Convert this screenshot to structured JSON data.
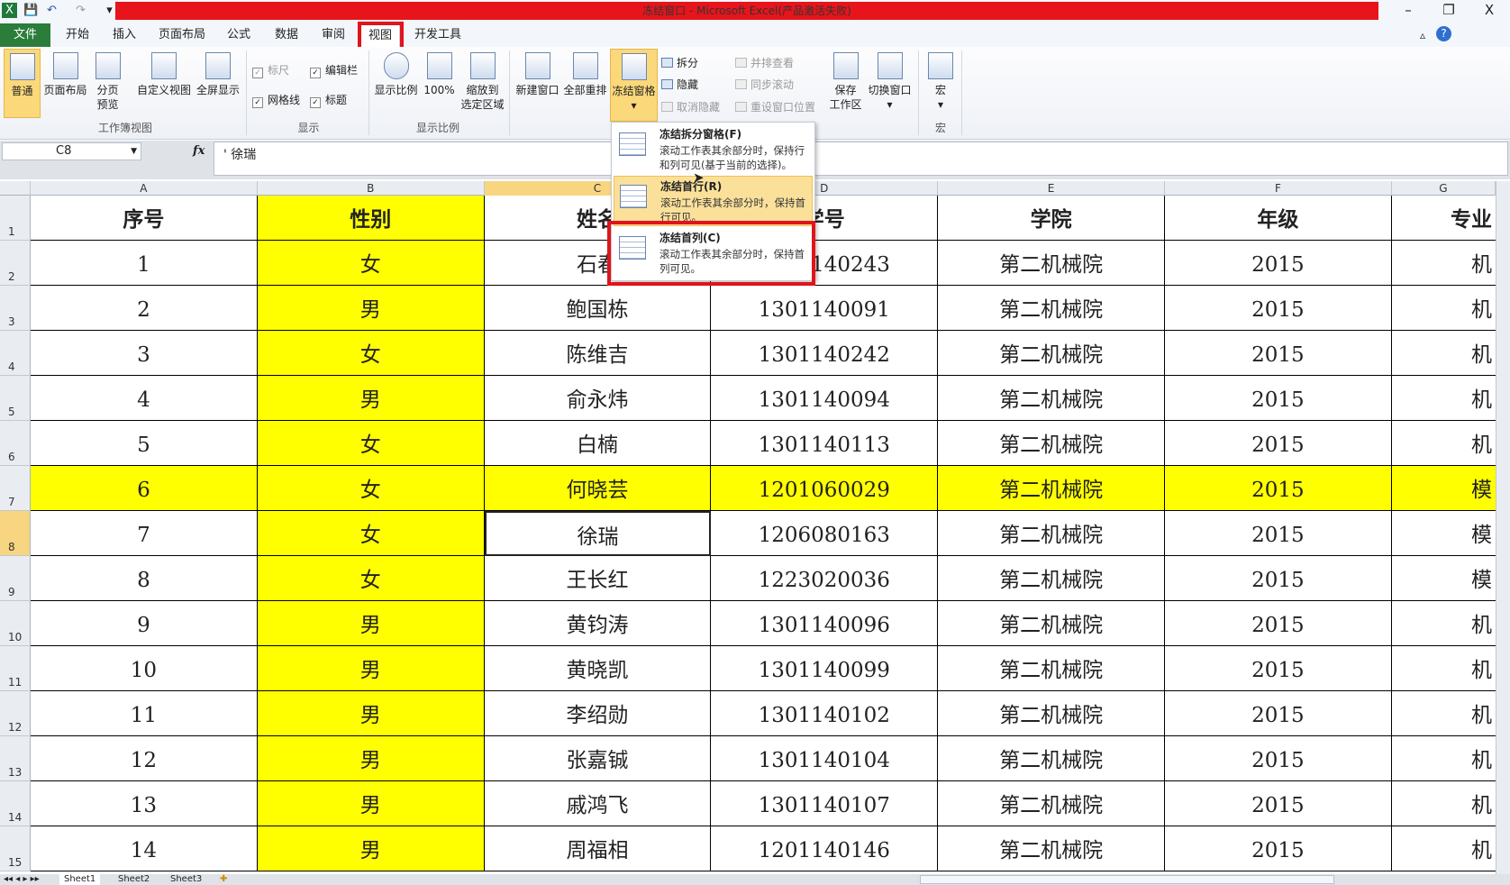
{
  "window": {
    "title": "冻结窗口 - Microsoft Excel(产品激活失败)",
    "minimize": "–",
    "restore": "❐",
    "close": "X"
  },
  "quick_access": {
    "excel": "X",
    "save": "💾",
    "undo": "↶",
    "redo": "↷",
    "customize": "▾"
  },
  "tabs": [
    "文件",
    "开始",
    "插入",
    "页面布局",
    "公式",
    "数据",
    "审阅",
    "视图",
    "开发工具"
  ],
  "active_tab": "视图",
  "ribbon": {
    "workbook_views": {
      "label": "工作簿视图",
      "items": [
        "普通",
        "页面布局",
        "分页\n预览",
        "自定义视图",
        "全屏显示"
      ]
    },
    "show": {
      "label": "显示",
      "ruler": "标尺",
      "formula_bar": "编辑栏",
      "gridlines": "网格线",
      "headings": "标题"
    },
    "zoom": {
      "label": "显示比例",
      "items": [
        "显示比例",
        "100%",
        "缩放到\n选定区域"
      ]
    },
    "window": {
      "new_window": "新建窗口",
      "arrange_all": "全部重排",
      "freeze_panes": "冻结窗格",
      "split": "拆分",
      "hide": "隐藏",
      "unhide": "取消隐藏",
      "side_by_side": "并排查看",
      "sync_scroll": "同步滚动",
      "reset_position": "重设窗口位置",
      "save_workspace": "保存\n工作区",
      "switch_windows": "切换窗口"
    },
    "macros": {
      "label": "宏",
      "item": "宏"
    }
  },
  "formula_bar": {
    "name_box": "C8",
    "fx": "fx",
    "value": "' 徐瑞"
  },
  "freeze_menu": [
    {
      "title": "冻结拆分窗格(F)",
      "desc": "滚动工作表其余部分时，保持行和列可见(基于当前的选择)。"
    },
    {
      "title": "冻结首行(R)",
      "desc": "滚动工作表其余部分时，保持首行可见。"
    },
    {
      "title": "冻结首列(C)",
      "desc": "滚动工作表其余部分时，保持首列可见。"
    }
  ],
  "columns": [
    "A",
    "B",
    "C",
    "D",
    "E",
    "F",
    "G"
  ],
  "selected_cell": "C8",
  "header_row": [
    "序号",
    "性别",
    "姓名",
    "学号",
    "学院",
    "年级",
    "专业"
  ],
  "rows": [
    [
      "1",
      "女",
      "石春",
      "1301140243",
      "第二机械院",
      "2015",
      "机"
    ],
    [
      "2",
      "男",
      "鲍国栋",
      "1301140091",
      "第二机械院",
      "2015",
      "机"
    ],
    [
      "3",
      "女",
      "陈维吉",
      "1301140242",
      "第二机械院",
      "2015",
      "机"
    ],
    [
      "4",
      "男",
      "俞永炜",
      "1301140094",
      "第二机械院",
      "2015",
      "机"
    ],
    [
      "5",
      "女",
      "白楠",
      "1301140113",
      "第二机械院",
      "2015",
      "机"
    ],
    [
      "6",
      "女",
      "何晓芸",
      "1201060029",
      "第二机械院",
      "2015",
      "模"
    ],
    [
      "7",
      "女",
      "徐瑞",
      "1206080163",
      "第二机械院",
      "2015",
      "模"
    ],
    [
      "8",
      "女",
      "王长红",
      "1223020036",
      "第二机械院",
      "2015",
      "模"
    ],
    [
      "9",
      "男",
      "黄钧涛",
      "1301140096",
      "第二机械院",
      "2015",
      "机"
    ],
    [
      "10",
      "男",
      "黄晓凯",
      "1301140099",
      "第二机械院",
      "2015",
      "机"
    ],
    [
      "11",
      "男",
      "李绍勋",
      "1301140102",
      "第二机械院",
      "2015",
      "机"
    ],
    [
      "12",
      "男",
      "张嘉铖",
      "1301140104",
      "第二机械院",
      "2015",
      "机"
    ],
    [
      "13",
      "男",
      "戚鸿飞",
      "1301140107",
      "第二机械院",
      "2015",
      "机"
    ],
    [
      "14",
      "男",
      "周福相",
      "1201140146",
      "第二机械院",
      "2015",
      "机"
    ]
  ],
  "sheets": [
    "Sheet1",
    "Sheet2",
    "Sheet3"
  ],
  "colors": {
    "title": "#e8141b",
    "highlight": "#ffff00",
    "file_tab": "#2a7d3b",
    "annotation": "#e0141c"
  }
}
